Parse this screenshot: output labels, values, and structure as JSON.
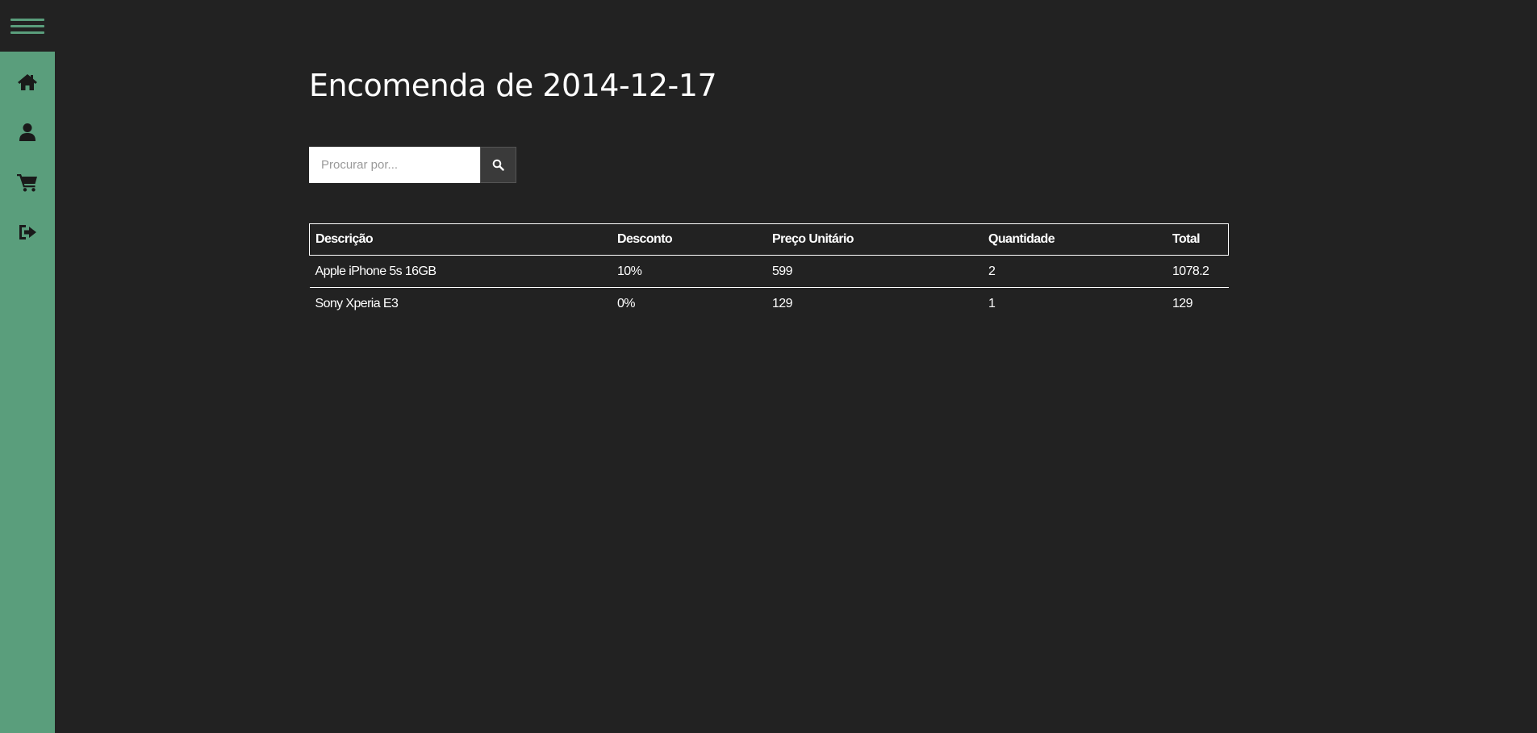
{
  "nav": {
    "menu_icon": "hamburger-icon",
    "items": [
      {
        "name": "home",
        "icon": "home-icon"
      },
      {
        "name": "user",
        "icon": "user-icon"
      },
      {
        "name": "cart",
        "icon": "cart-icon"
      },
      {
        "name": "logout",
        "icon": "sign-out-icon"
      }
    ]
  },
  "page": {
    "title": "Encomenda de 2014-12-17"
  },
  "search": {
    "placeholder": "Procurar por...",
    "value": "",
    "button_icon": "search-icon"
  },
  "table": {
    "headers": [
      "Descrição",
      "Desconto",
      "Preço Unitário",
      "Quantidade",
      "Total"
    ],
    "rows": [
      [
        "Apple iPhone 5s 16GB",
        "10%",
        "599",
        "2",
        "1078.2"
      ],
      [
        "Sony Xperia E3",
        "0%",
        "129",
        "1",
        "129"
      ]
    ]
  },
  "colors": {
    "background": "#222222",
    "sidebar": "#5a9e7c",
    "text": "#ffffff",
    "icon": "#1a1a1a"
  }
}
